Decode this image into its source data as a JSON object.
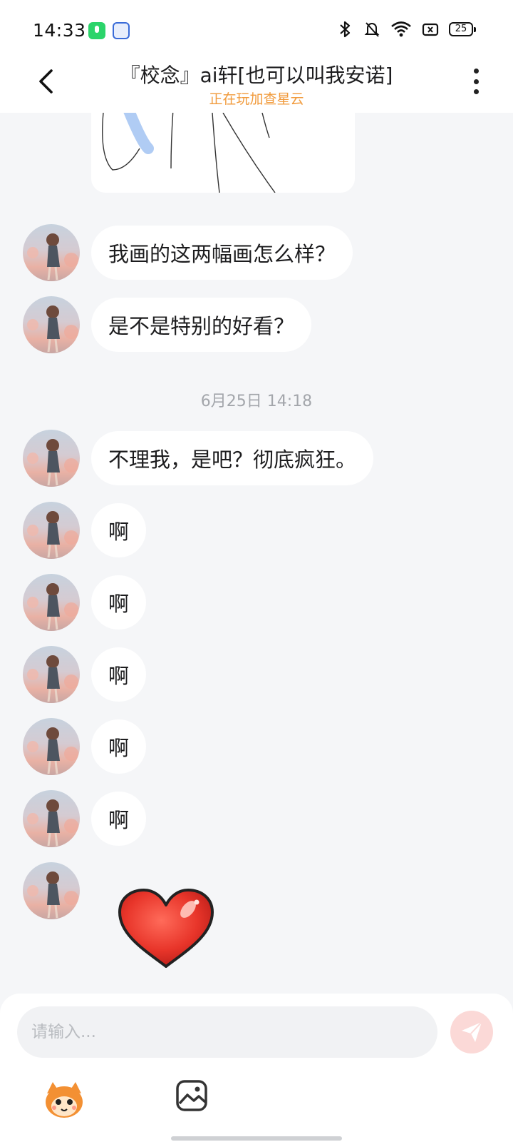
{
  "status_bar": {
    "time": "14:33",
    "battery": "25",
    "icons": [
      "mic-app-icon",
      "baidu-app-icon",
      "bluetooth-icon",
      "mute-icon",
      "wifi-icon",
      "sim-icon",
      "battery-icon"
    ]
  },
  "header": {
    "title": "『校念』ai轩[也可以叫我安诺]",
    "subtitle": "正在玩加查星云",
    "subtitle_color": "#f19a3b"
  },
  "messages": [
    {
      "text": "我画的这两幅画怎么样？"
    },
    {
      "text": "是不是特别的好看？"
    },
    {
      "text": "不理我，是吧？彻底疯狂。"
    },
    {
      "text": "啊"
    },
    {
      "text": "啊"
    },
    {
      "text": "啊"
    },
    {
      "text": "啊"
    },
    {
      "text": "啊"
    }
  ],
  "timestamp": "6月25日 14:18",
  "sticker": "heart-sticker",
  "composer": {
    "placeholder": "请输入...",
    "send_color": "#fbd9d7",
    "tools": [
      "emoji-mascot-icon",
      "image-icon"
    ]
  }
}
